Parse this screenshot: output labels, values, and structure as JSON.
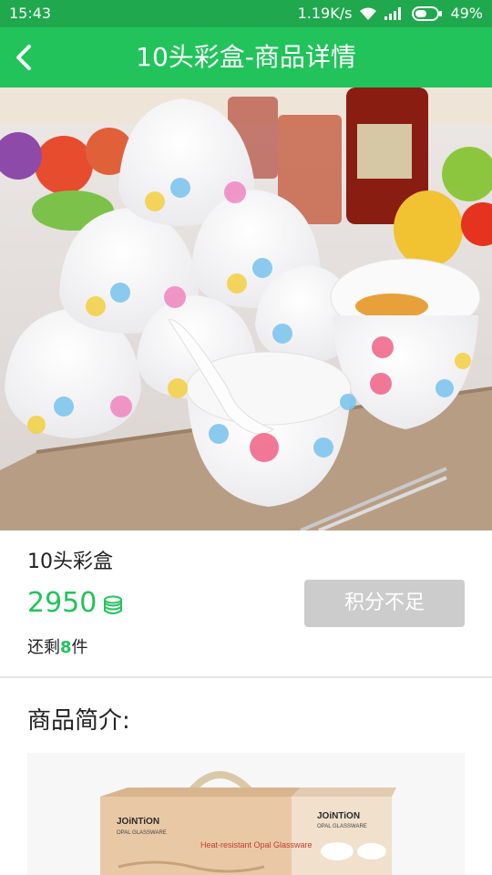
{
  "status_bar": {
    "time": "15:43",
    "network_speed": "1.19K/s",
    "battery": "49%"
  },
  "header": {
    "title": "10头彩盒-商品详情"
  },
  "product": {
    "name": "10头彩盒",
    "price": "2950",
    "stock_prefix": "还剩",
    "stock_count": "8",
    "stock_suffix": "件",
    "button_label": "积分不足"
  },
  "intro": {
    "title": "商品简介:",
    "box_brand": "JOiNTiON",
    "box_subbrand": "OPAL GLASSWARE",
    "box_tagline": "Heat-resistant Opal Glassware"
  },
  "colors": {
    "status_bar": "#1fa84e",
    "accent": "#22c35b",
    "disabled_button": "#cccccc"
  },
  "icons": {
    "back": "chevron-left-icon",
    "coin": "coin-stack-icon",
    "wifi": "wifi-icon",
    "signal": "signal-icon",
    "battery": "battery-icon"
  }
}
